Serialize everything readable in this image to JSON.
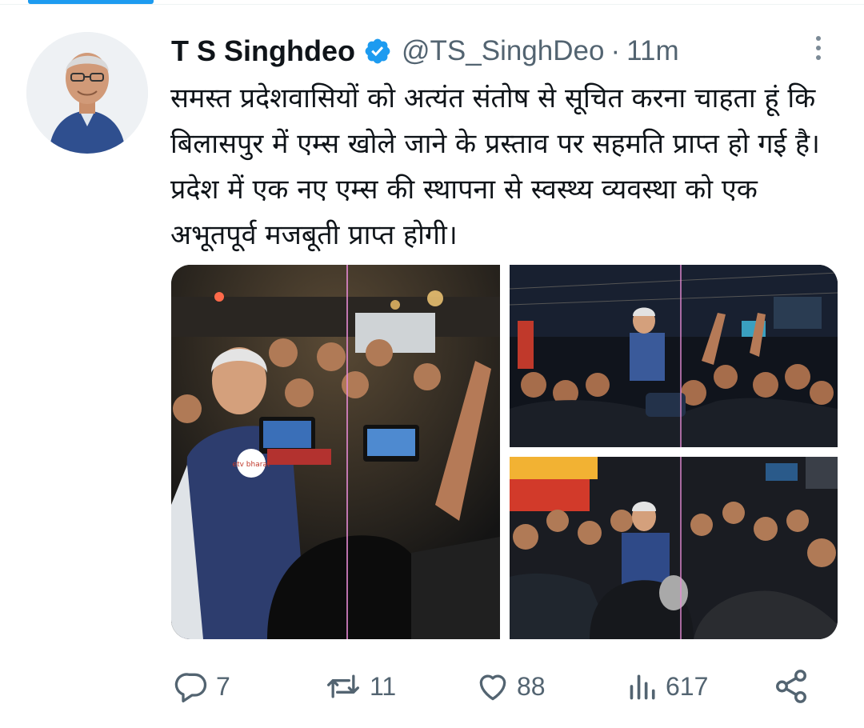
{
  "tweet": {
    "author_name": "T S Singhdeo",
    "handle": "@TS_SinghDeo",
    "separator": "·",
    "time_ago": "11m",
    "text": "समस्त प्रदेशवासियों को अत्यंत संतोष से सूचित करना चाहता हूं कि बिलासपुर में एम्स खोले जाने के प्रस्ताव पर सहमति प्राप्त हो गई है। प्रदेश में एक नए एम्स की स्थापना से स्वस्थ्य व्यवस्था को एक अभूतपूर्व मजबूती प्राप्त होगी।"
  },
  "media": {
    "photo_1_mic_logo": "etv bharat"
  },
  "actions": {
    "replies": "7",
    "retweets": "11",
    "likes": "88",
    "views": "617"
  },
  "icons": {
    "verified": "verified-badge-icon",
    "more": "more-options-icon",
    "reply": "reply-icon",
    "retweet": "retweet-icon",
    "like": "heart-icon",
    "views": "analytics-icon",
    "share": "share-icon"
  },
  "colors": {
    "accent": "#1d9bf0",
    "text": "#0f1419",
    "secondary": "#536471"
  }
}
